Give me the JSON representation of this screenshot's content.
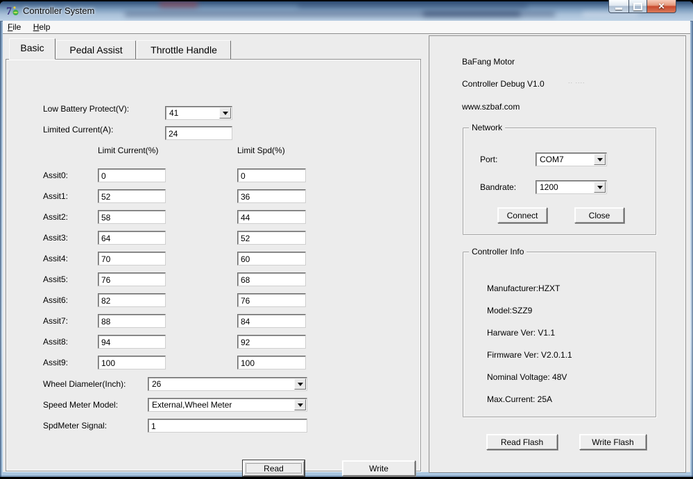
{
  "window": {
    "title": "Controller System",
    "menu": {
      "file": "File",
      "help": "Help"
    }
  },
  "tabs": [
    {
      "label": "Basic"
    },
    {
      "label": "Pedal Assist"
    },
    {
      "label": "Throttle Handle"
    }
  ],
  "basic": {
    "low_battery_label": "Low Battery Protect(V):",
    "low_battery_value": "41",
    "limited_current_label": "Limited Current(A):",
    "limited_current_value": "24",
    "col_current_header": "Limit Current(%)",
    "col_spd_header": "Limit Spd(%)",
    "assist_rows": [
      {
        "label": "Assit0:",
        "current": "0",
        "spd": "0"
      },
      {
        "label": "Assit1:",
        "current": "52",
        "spd": "36"
      },
      {
        "label": "Assit2:",
        "current": "58",
        "spd": "44"
      },
      {
        "label": "Assit3:",
        "current": "64",
        "spd": "52"
      },
      {
        "label": "Assit4:",
        "current": "70",
        "spd": "60"
      },
      {
        "label": "Assit5:",
        "current": "76",
        "spd": "68"
      },
      {
        "label": "Assit6:",
        "current": "82",
        "spd": "76"
      },
      {
        "label": "Assit7:",
        "current": "88",
        "spd": "84"
      },
      {
        "label": "Assit8:",
        "current": "94",
        "spd": "92"
      },
      {
        "label": "Assit9:",
        "current": "100",
        "spd": "100"
      }
    ],
    "wheel_label": "Wheel Diameler(Inch):",
    "wheel_value": "26",
    "speed_meter_label": "Speed Meter Model:",
    "speed_meter_value": "External,Wheel Meter",
    "spdmeter_label": "SpdMeter Signal:",
    "spdmeter_value": "1",
    "read_button": "Read",
    "write_button": "Write"
  },
  "right": {
    "brand_line1": "BaFang Motor",
    "brand_line2": "Controller Debug V1.0",
    "brand_line3": "www.szbaf.com",
    "artifact": ".. ....",
    "network": {
      "title": "Network",
      "port_label": "Port:",
      "port_value": "COM7",
      "bandrate_label": "Bandrate:",
      "bandrate_value": "1200",
      "connect_button": "Connect",
      "close_button": "Close"
    },
    "info": {
      "title": "Controller Info",
      "lines": [
        "Manufacturer:HZXT",
        "Model:SZZ9",
        "Harware Ver: V1.1",
        "Firmware Ver: V2.0.1.1",
        "Nominal Voltage: 48V",
        "Max.Current: 25A"
      ]
    },
    "read_flash_button": "Read Flash",
    "write_flash_button": "Write Flash"
  },
  "colors": {
    "titlebar_glass": "#7c9cbd",
    "close_button_red": "#c84a2e",
    "client_background": "#ececec"
  }
}
